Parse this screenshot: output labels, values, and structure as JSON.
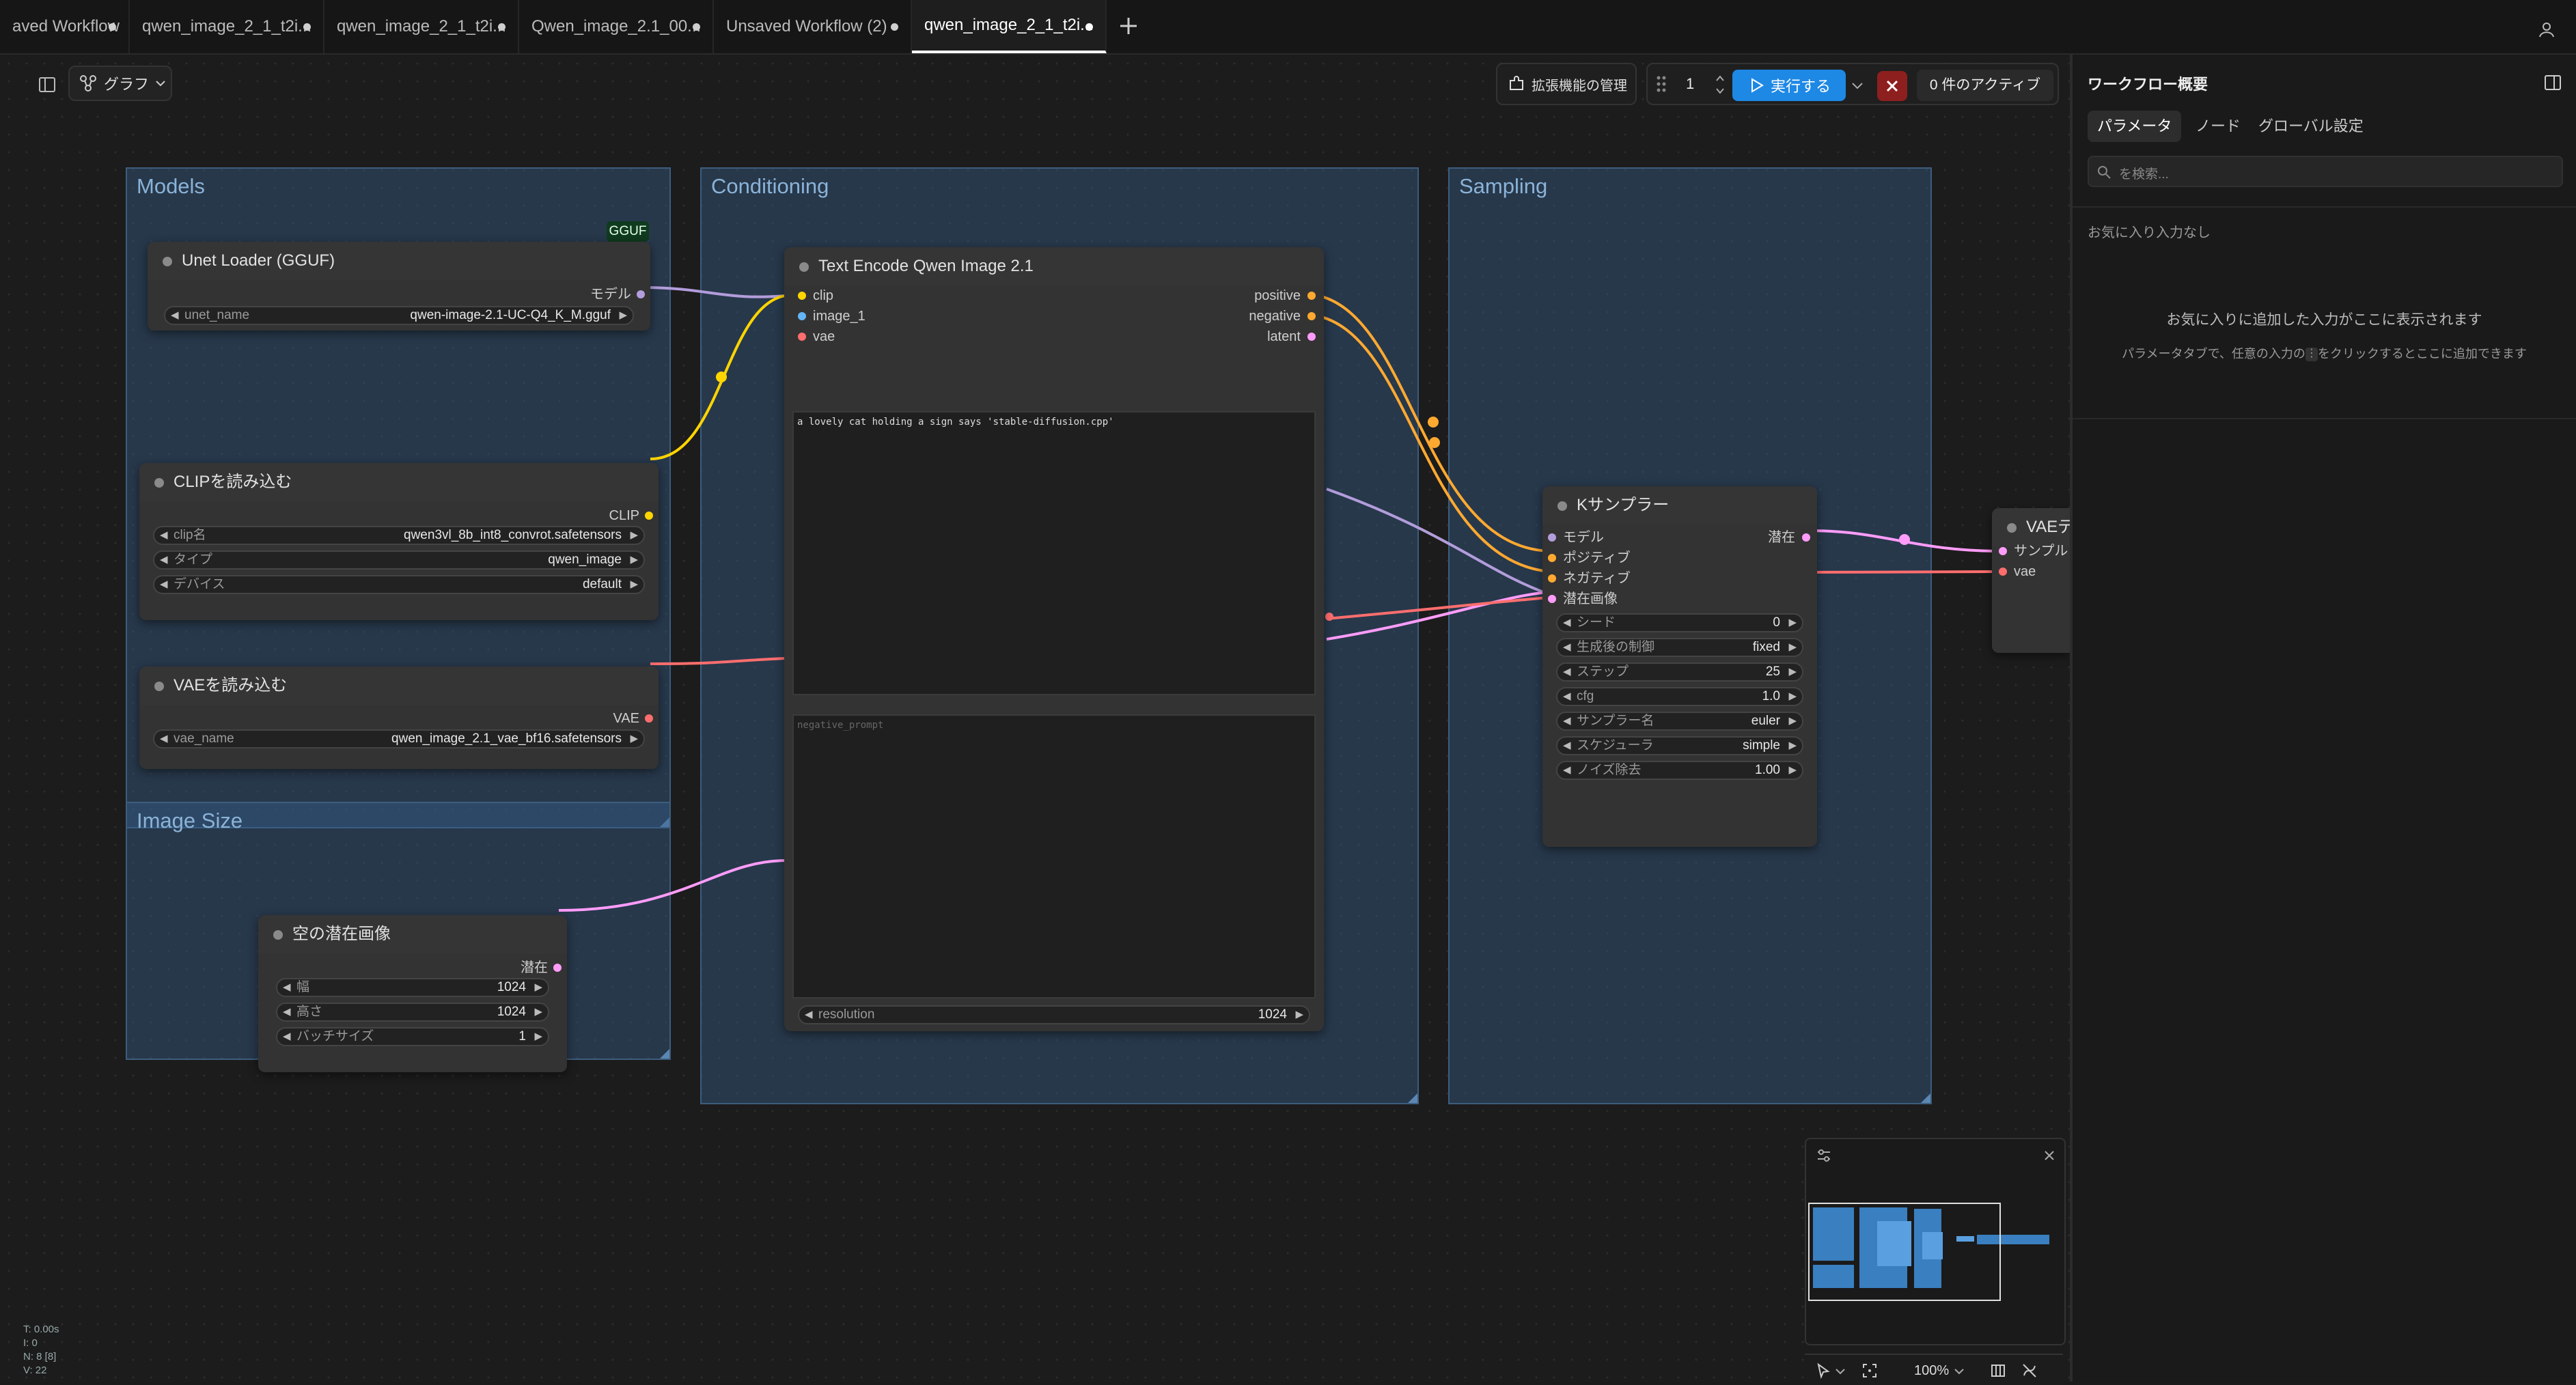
{
  "tabs": [
    {
      "label": "aved Workflow"
    },
    {
      "label": "qwen_image_2_1_t2i..."
    },
    {
      "label": "qwen_image_2_1_t2i..."
    },
    {
      "label": "Qwen_image_2.1_00..."
    },
    {
      "label": "Unsaved Workflow (2)"
    },
    {
      "label": "qwen_image_2_1_t2i..."
    }
  ],
  "toolbar": {
    "graph_label": "グラフ",
    "extensions_label": "拡張機能の管理",
    "queue_count": "1",
    "run_label": "実行する",
    "active_label": "0 件のアクティブ"
  },
  "groups": {
    "models": "Models",
    "conditioning": "Conditioning",
    "sampling": "Sampling",
    "image_size": "Image Size"
  },
  "nodes": {
    "unet": {
      "badge": "GGUF",
      "title": "Unet Loader (GGUF)",
      "out_model": "モデル",
      "w_unet_name": {
        "label": "unet_name",
        "value": "qwen-image-2.1-UC-Q4_K_M.gguf"
      }
    },
    "clip": {
      "title": "CLIPを読み込む",
      "out_clip": "CLIP",
      "w_clip_name": {
        "label": "clip名",
        "value": "qwen3vl_8b_int8_convrot.safetensors"
      },
      "w_type": {
        "label": "タイプ",
        "value": "qwen_image"
      },
      "w_device": {
        "label": "デバイス",
        "value": "default"
      }
    },
    "vae": {
      "title": "VAEを読み込む",
      "out_vae": "VAE",
      "w_vae_name": {
        "label": "vae_name",
        "value": "qwen_image_2.1_vae_bf16.safetensors"
      }
    },
    "latent": {
      "title": "空の潜在画像",
      "out_latent": "潜在",
      "w_width": {
        "label": "幅",
        "value": "1024"
      },
      "w_height": {
        "label": "高さ",
        "value": "1024"
      },
      "w_batch": {
        "label": "バッチサイズ",
        "value": "1"
      }
    },
    "encode": {
      "title": "Text Encode Qwen Image 2.1",
      "in_clip": "clip",
      "in_image": "image_1",
      "in_vae": "vae",
      "out_positive": "positive",
      "out_negative": "negative",
      "out_latent": "latent",
      "positive_text": "a lovely cat holding a sign says 'stable-diffusion.cpp'",
      "negative_placeholder": "negative_prompt",
      "w_resolution": {
        "label": "resolution",
        "value": "1024"
      }
    },
    "ksampler": {
      "title": "Kサンプラー",
      "in_model": "モデル",
      "in_positive": "ポジティブ",
      "in_negative": "ネガティブ",
      "in_latent": "潜在画像",
      "out_latent": "潜在",
      "w_seed": {
        "label": "シード",
        "value": "0"
      },
      "w_control": {
        "label": "生成後の制御",
        "value": "fixed"
      },
      "w_steps": {
        "label": "ステップ",
        "value": "25"
      },
      "w_cfg": {
        "label": "cfg",
        "value": "1.0"
      },
      "w_sampler": {
        "label": "サンプラー名",
        "value": "euler"
      },
      "w_scheduler": {
        "label": "スケジューラ",
        "value": "simple"
      },
      "w_denoise": {
        "label": "ノイズ除去",
        "value": "1.00"
      }
    },
    "vaedecode": {
      "title": "VAEデ",
      "in_samples": "サンプル",
      "in_vae": "vae"
    }
  },
  "panel": {
    "title": "ワークフロー概要",
    "tabs": [
      "パラメータ",
      "ノード",
      "グローバル設定"
    ],
    "search_placeholder": "を検索...",
    "favorites_empty": "お気に入り入力なし",
    "hint_title": "お気に入りに追加した入力がここに表示されます",
    "hint_before": "パラメータタブで、任意の入力の",
    "hint_after": "をクリックするとここに追加できます"
  },
  "zoom": "100%",
  "stats": {
    "t": "T: 0.00s",
    "i": "I: 0",
    "n": "N: 8 [8]",
    "v": "V: 22"
  },
  "colors": {
    "group_fill": "#375f8c",
    "clip": "#ffd500",
    "conditioning": "#ffa931",
    "model": "#b39ddb",
    "vae": "#ff6e6e",
    "latent": "#ff9cf9",
    "image": "#64b5f6",
    "run_button": "#1e88e5",
    "stop_button": "#b71c1c"
  }
}
